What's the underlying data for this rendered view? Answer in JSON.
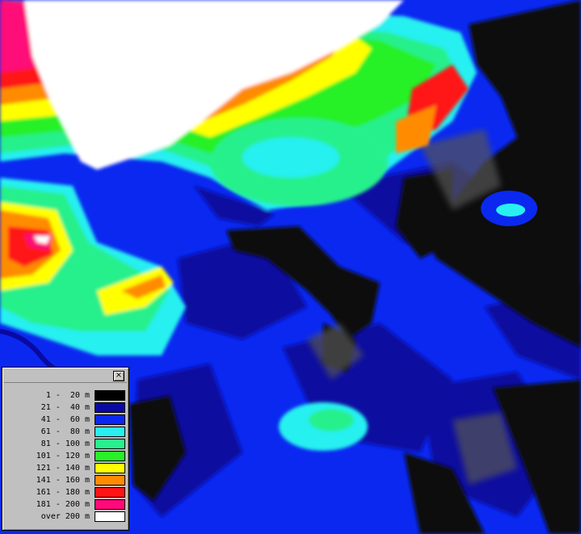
{
  "legend": {
    "close_glyph": "×",
    "entries": [
      {
        "label": "1 -  20 m",
        "color": "#000000"
      },
      {
        "label": "21 -  40 m",
        "color": "#0a0aa0"
      },
      {
        "label": "41 -  60 m",
        "color": "#0a28f0"
      },
      {
        "label": "61 -  80 m",
        "color": "#28f0f0"
      },
      {
        "label": "81 - 100 m",
        "color": "#28f08c"
      },
      {
        "label": "101 - 120 m",
        "color": "#28f028"
      },
      {
        "label": "121 - 140 m",
        "color": "#ffff00"
      },
      {
        "label": "141 - 160 m",
        "color": "#ff8c00"
      },
      {
        "label": "161 - 180 m",
        "color": "#ff1414"
      },
      {
        "label": "181 - 200 m",
        "color": "#ff0a78"
      },
      {
        "label": "over 200 m",
        "color": "#ffffff"
      }
    ]
  }
}
